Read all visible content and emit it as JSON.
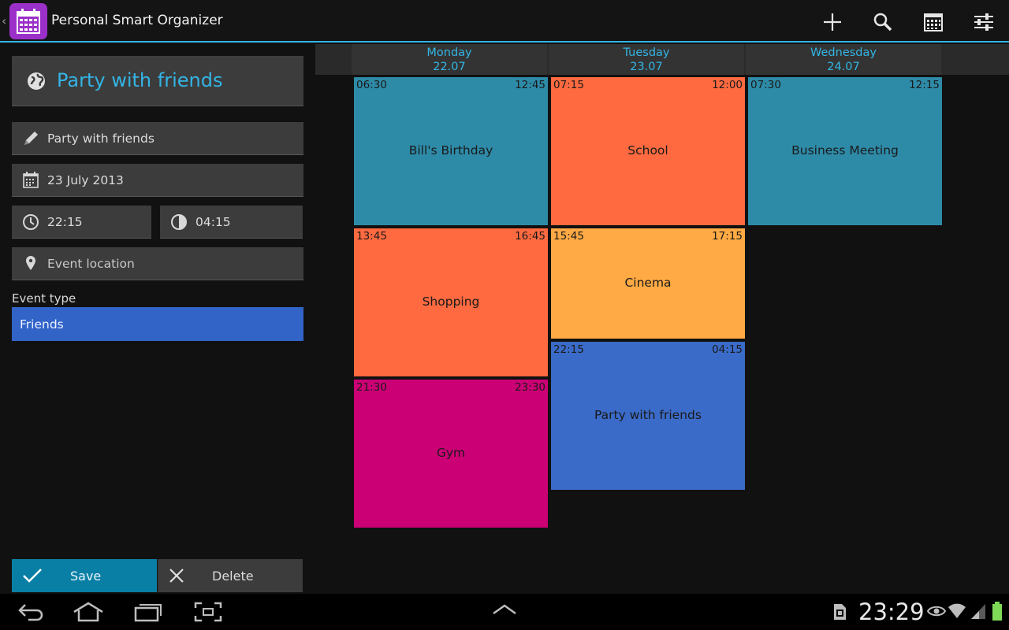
{
  "app": {
    "title": "Personal Smart Organizer"
  },
  "actions": [
    {
      "name": "add-icon"
    },
    {
      "name": "search-icon"
    },
    {
      "name": "calendar-icon"
    },
    {
      "name": "settings-sliders-icon"
    }
  ],
  "editor": {
    "title": "Party with friends",
    "name_value": "Party with friends",
    "date_value": "23 July 2013",
    "start_time": "22:15",
    "end_time": "04:15",
    "location_placeholder": "Event location",
    "event_type_label": "Event type",
    "event_type_value": "Friends",
    "save_label": "Save",
    "delete_label": "Delete"
  },
  "calendar": {
    "days": [
      {
        "name": "Monday",
        "date": "22.07"
      },
      {
        "name": "Tuesday",
        "date": "23.07"
      },
      {
        "name": "Wednesday",
        "date": "24.07"
      }
    ],
    "events": [
      {
        "day": 0,
        "start": "06:30",
        "end": "12:45",
        "name": "Bill's Birthday",
        "color": "#2e8ba8"
      },
      {
        "day": 0,
        "start": "13:45",
        "end": "16:45",
        "name": "Shopping",
        "color": "#ff6a40"
      },
      {
        "day": 0,
        "start": "21:30",
        "end": "23:30",
        "name": "Gym",
        "color": "#cc0075"
      },
      {
        "day": 1,
        "start": "07:15",
        "end": "12:00",
        "name": "School",
        "color": "#ff6a40"
      },
      {
        "day": 1,
        "start": "15:45",
        "end": "17:15",
        "name": "Cinema",
        "color": "#ffaa44"
      },
      {
        "day": 1,
        "start": "22:15",
        "end": "04:15",
        "name": "Party with friends",
        "color": "#3b6bc8"
      },
      {
        "day": 2,
        "start": "07:30",
        "end": "12:15",
        "name": "Business Meeting",
        "color": "#2e8ba8"
      }
    ]
  },
  "system": {
    "clock": "23:29"
  }
}
